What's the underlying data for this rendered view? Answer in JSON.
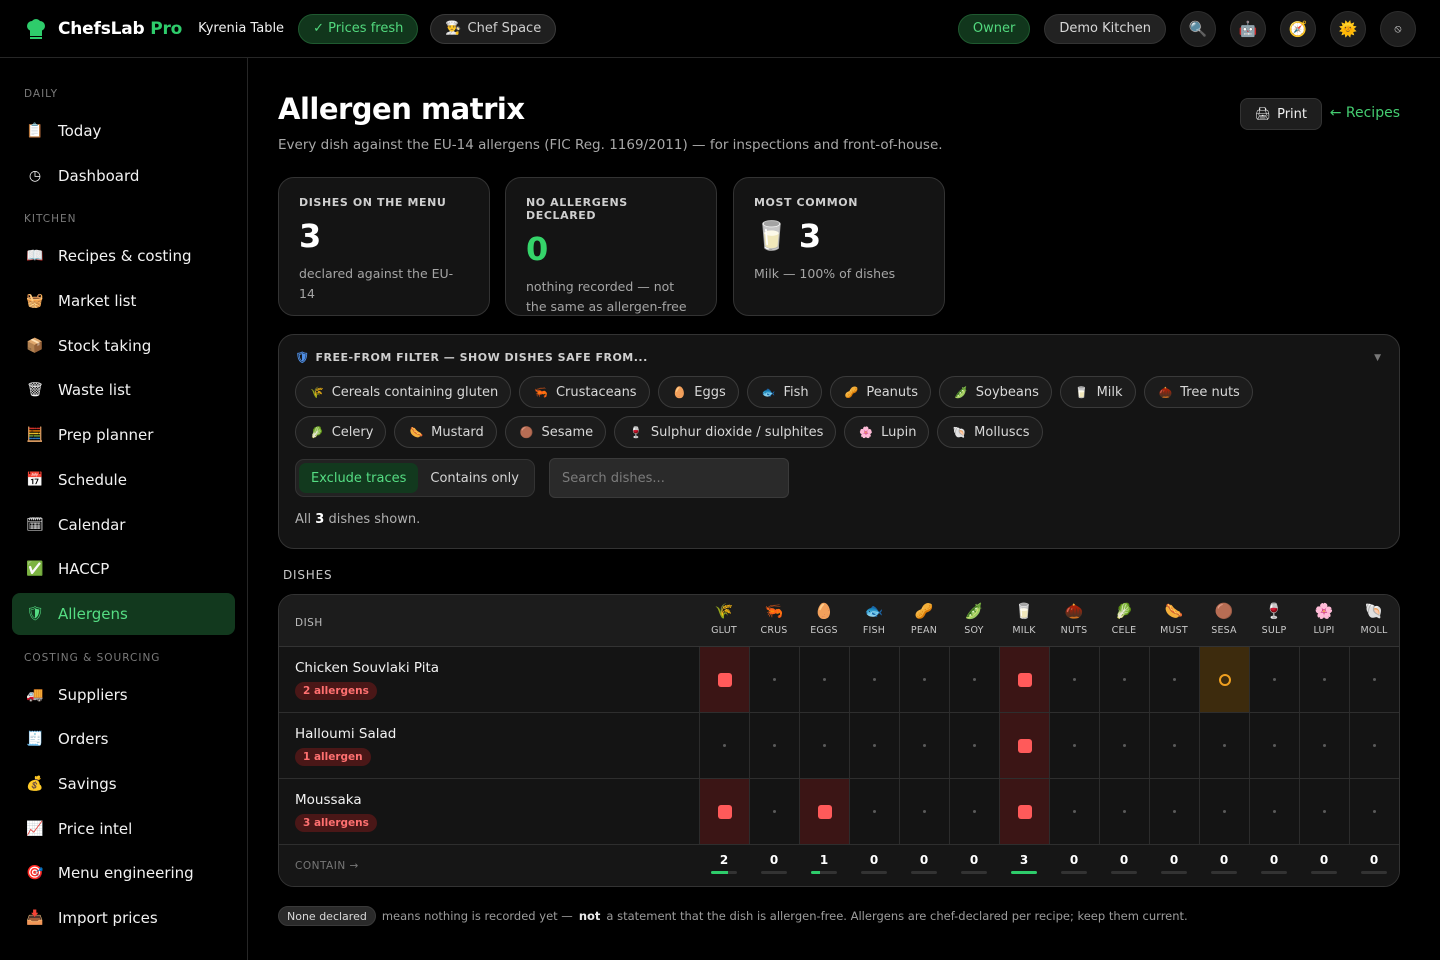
{
  "topbar": {
    "brand_name": "ChefsLab",
    "brand_suffix": "Pro",
    "org_name": "Kyrenia Table",
    "prices_pill": "✓ Prices fresh",
    "chef_space": "Chef Space",
    "owner": "Owner",
    "kitchen": "Demo Kitchen",
    "icons": [
      "search-icon",
      "robot-icon",
      "compass-icon",
      "sun-icon",
      "power-icon"
    ]
  },
  "sidebar": {
    "sections": [
      {
        "title": "DAILY",
        "items": [
          {
            "label": "Today",
            "icon": "📋"
          },
          {
            "label": "Dashboard",
            "icon": "◷"
          }
        ]
      },
      {
        "title": "KITCHEN",
        "items": [
          {
            "label": "Recipes & costing",
            "icon": "📖"
          },
          {
            "label": "Market list",
            "icon": "🧺"
          },
          {
            "label": "Stock taking",
            "icon": "📦"
          },
          {
            "label": "Waste list",
            "icon": "🗑"
          },
          {
            "label": "Prep planner",
            "icon": "🧮"
          },
          {
            "label": "Schedule",
            "icon": "📅"
          },
          {
            "label": "Calendar",
            "icon": "🗓"
          },
          {
            "label": "HACCP",
            "icon": "✅"
          },
          {
            "label": "Allergens",
            "icon": "🛡",
            "active": true
          }
        ]
      },
      {
        "title": "COSTING & SOURCING",
        "items": [
          {
            "label": "Suppliers",
            "icon": "🚚"
          },
          {
            "label": "Orders",
            "icon": "🧾"
          },
          {
            "label": "Savings",
            "icon": "💰"
          },
          {
            "label": "Price intel",
            "icon": "📈"
          },
          {
            "label": "Menu engineering",
            "icon": "🎯"
          },
          {
            "label": "Import prices",
            "icon": "📥"
          }
        ]
      }
    ]
  },
  "page": {
    "title": "Allergen matrix",
    "subtitle": "Every dish against the EU-14 allergens (FIC Reg. 1169/2011) — for inspections and front-of-house.",
    "print_label": "Print",
    "back_label": "← Recipes"
  },
  "stats": [
    {
      "label": "DISHES ON THE MENU",
      "value": "3",
      "desc": "declared against the EU-14"
    },
    {
      "label": "NO ALLERGENS DECLARED",
      "value": "0",
      "desc": "nothing recorded — not the same as allergen-free"
    },
    {
      "label": "MOST COMMON",
      "value": "3",
      "desc": "Milk — 100% of dishes",
      "icon": "🥛"
    }
  ],
  "filter": {
    "title": "FREE-FROM FILTER — SHOW DISHES SAFE FROM...",
    "chips": [
      {
        "label": "Cereals containing gluten",
        "icon": "🌾"
      },
      {
        "label": "Crustaceans",
        "icon": "🦐"
      },
      {
        "label": "Eggs",
        "icon": "🥚"
      },
      {
        "label": "Fish",
        "icon": "🐟"
      },
      {
        "label": "Peanuts",
        "icon": "🥜"
      },
      {
        "label": "Soybeans",
        "icon": "🫛"
      },
      {
        "label": "Milk",
        "icon": "🥛"
      },
      {
        "label": "Tree nuts",
        "icon": "🌰"
      },
      {
        "label": "Celery",
        "icon": "🥬"
      },
      {
        "label": "Mustard",
        "icon": "🌭"
      },
      {
        "label": "Sesame",
        "icon": "🟤"
      },
      {
        "label": "Sulphur dioxide / sulphites",
        "icon": "🍷"
      },
      {
        "label": "Lupin",
        "icon": "🌸"
      },
      {
        "label": "Molluscs",
        "icon": "🐚"
      }
    ],
    "mode_exclude": "Exclude traces",
    "mode_contains": "Contains only",
    "search_placeholder": "Search dishes...",
    "shown_prefix": "All",
    "shown_count": "3",
    "shown_suffix": "dishes shown."
  },
  "matrix": {
    "section_title": "DISHES",
    "dish_header": "DISH",
    "columns": [
      {
        "code": "GLUT",
        "icon": "🌾"
      },
      {
        "code": "CRUS",
        "icon": "🦐"
      },
      {
        "code": "EGGS",
        "icon": "🥚"
      },
      {
        "code": "FISH",
        "icon": "🐟"
      },
      {
        "code": "PEAN",
        "icon": "🥜"
      },
      {
        "code": "SOY",
        "icon": "🫛"
      },
      {
        "code": "MILK",
        "icon": "🥛"
      },
      {
        "code": "NUTS",
        "icon": "🌰"
      },
      {
        "code": "CELE",
        "icon": "🥬"
      },
      {
        "code": "MUST",
        "icon": "🌭"
      },
      {
        "code": "SESA",
        "icon": "🟤"
      },
      {
        "code": "SULP",
        "icon": "🍷"
      },
      {
        "code": "LUPI",
        "icon": "🌸"
      },
      {
        "code": "MOLL",
        "icon": "🐚"
      }
    ],
    "rows": [
      {
        "name": "Chicken Souvlaki Pita",
        "badge": "2 allergens",
        "cells": [
          "has",
          "none",
          "none",
          "none",
          "none",
          "none",
          "has",
          "none",
          "none",
          "none",
          "trace",
          "none",
          "none",
          "none"
        ]
      },
      {
        "name": "Halloumi Salad",
        "badge": "1 allergen",
        "cells": [
          "none",
          "none",
          "none",
          "none",
          "none",
          "none",
          "has",
          "none",
          "none",
          "none",
          "none",
          "none",
          "none",
          "none"
        ]
      },
      {
        "name": "Moussaka",
        "badge": "3 allergens",
        "cells": [
          "has",
          "none",
          "has",
          "none",
          "none",
          "none",
          "has",
          "none",
          "none",
          "none",
          "none",
          "none",
          "none",
          "none"
        ]
      }
    ],
    "footer_label": "CONTAIN →",
    "counts": [
      2,
      0,
      1,
      0,
      0,
      0,
      3,
      0,
      0,
      0,
      0,
      0,
      0,
      0
    ],
    "count_total": 3
  },
  "footnote": {
    "badge": "None declared",
    "text_a": "means nothing is recorded yet —",
    "text_bold": "not",
    "text_b": "a statement that the dish is allergen-free. Allergens are chef-declared per recipe; keep them current."
  },
  "colors": {
    "accent_green": "#2ecc6b",
    "allergen_red": "#ff5a5a",
    "trace_amber": "#f0a020"
  }
}
